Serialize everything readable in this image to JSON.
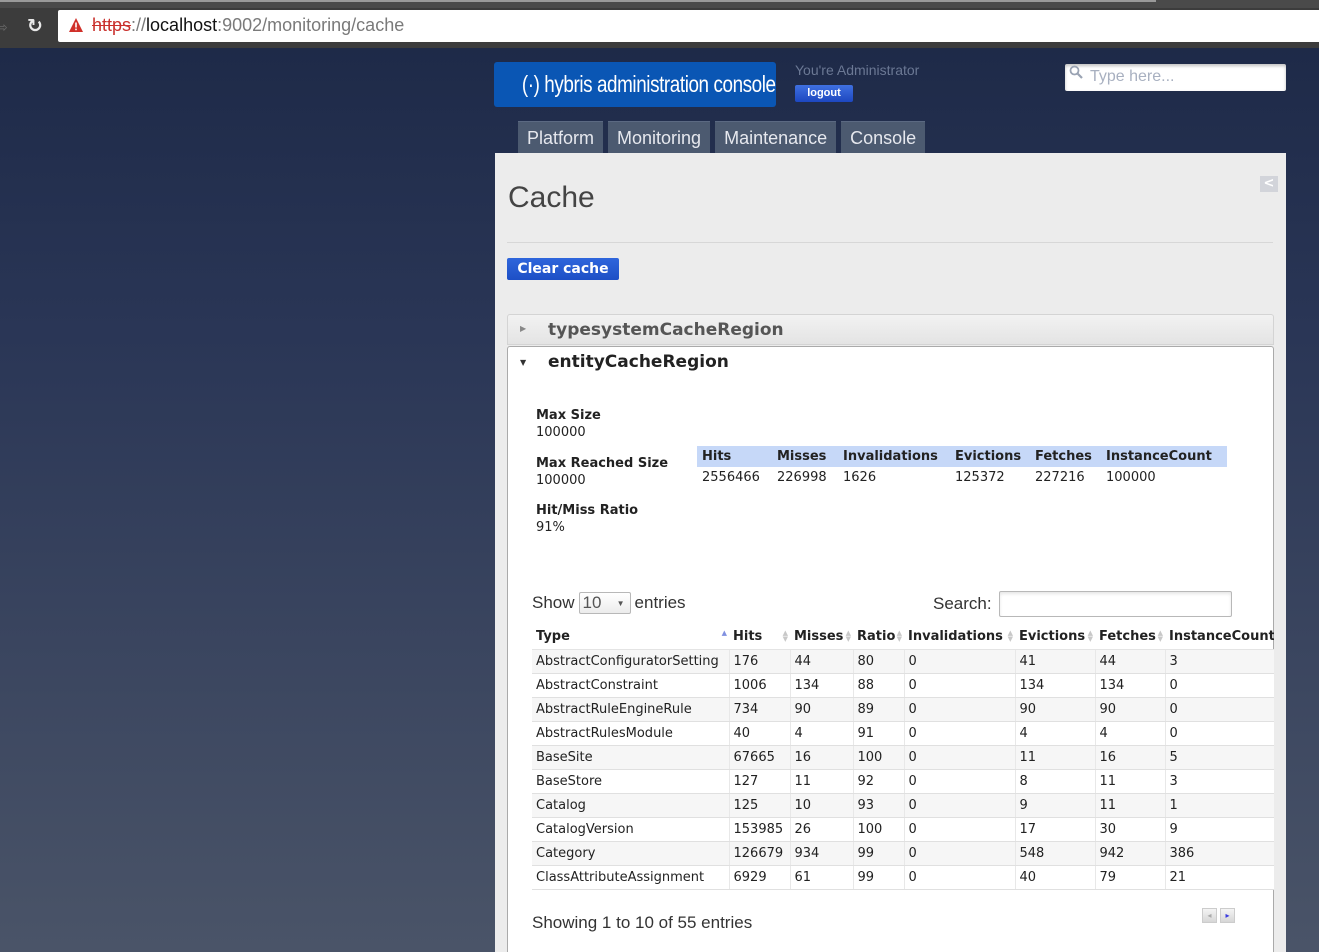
{
  "browser": {
    "url_scheme": "https",
    "url_sep": "://",
    "url_host": "localhost",
    "url_rest": ":9002/monitoring/cache"
  },
  "header": {
    "logo_text": "(·) hybris administration console",
    "user_label": "You're Administrator",
    "logout_label": "logout",
    "search_placeholder": "Type here..."
  },
  "nav": {
    "tabs": [
      {
        "label": "Platform"
      },
      {
        "label": "Monitoring"
      },
      {
        "label": "Maintenance"
      },
      {
        "label": "Console"
      }
    ]
  },
  "page": {
    "title": "Cache",
    "collapse_glyph": "<",
    "clear_cache_label": "Clear cache"
  },
  "regions": {
    "closed": {
      "title": "typesystemCacheRegion"
    },
    "open": {
      "title": "entityCacheRegion",
      "max_size_label": "Max Size",
      "max_size": "100000",
      "max_reached_label": "Max Reached Size",
      "max_reached": "100000",
      "ratio_label": "Hit/Miss Ratio",
      "ratio": "91%",
      "summary": {
        "headers": [
          "Hits",
          "Misses",
          "Invalidations",
          "Evictions",
          "Fetches",
          "InstanceCount"
        ],
        "values": [
          "2556466",
          "226998",
          "1626",
          "125372",
          "227216",
          "100000"
        ]
      }
    }
  },
  "datatable": {
    "show_label": "Show",
    "page_length": "10",
    "entries_label": "entries",
    "search_label": "Search:",
    "search_value": "",
    "columns": [
      "Type",
      "Hits",
      "Misses",
      "Ratio",
      "Invalidations",
      "Evictions",
      "Fetches",
      "InstanceCount"
    ],
    "sorted_column": "Type",
    "sort_direction": "asc",
    "rows": [
      [
        "AbstractConfiguratorSetting",
        "176",
        "44",
        "80",
        "0",
        "41",
        "44",
        "3"
      ],
      [
        "AbstractConstraint",
        "1006",
        "134",
        "88",
        "0",
        "134",
        "134",
        "0"
      ],
      [
        "AbstractRuleEngineRule",
        "734",
        "90",
        "89",
        "0",
        "90",
        "90",
        "0"
      ],
      [
        "AbstractRulesModule",
        "40",
        "4",
        "91",
        "0",
        "4",
        "4",
        "0"
      ],
      [
        "BaseSite",
        "67665",
        "16",
        "100",
        "0",
        "11",
        "16",
        "5"
      ],
      [
        "BaseStore",
        "127",
        "11",
        "92",
        "0",
        "8",
        "11",
        "3"
      ],
      [
        "Catalog",
        "125",
        "10",
        "93",
        "0",
        "9",
        "11",
        "1"
      ],
      [
        "CatalogVersion",
        "153985",
        "26",
        "100",
        "0",
        "17",
        "30",
        "9"
      ],
      [
        "Category",
        "126679",
        "934",
        "99",
        "0",
        "548",
        "942",
        "386"
      ],
      [
        "ClassAttributeAssignment",
        "6929",
        "61",
        "99",
        "0",
        "40",
        "79",
        "21"
      ]
    ],
    "info": "Showing 1 to 10 of 55 entries",
    "prev_glyph": "◂",
    "next_glyph": "▸"
  }
}
